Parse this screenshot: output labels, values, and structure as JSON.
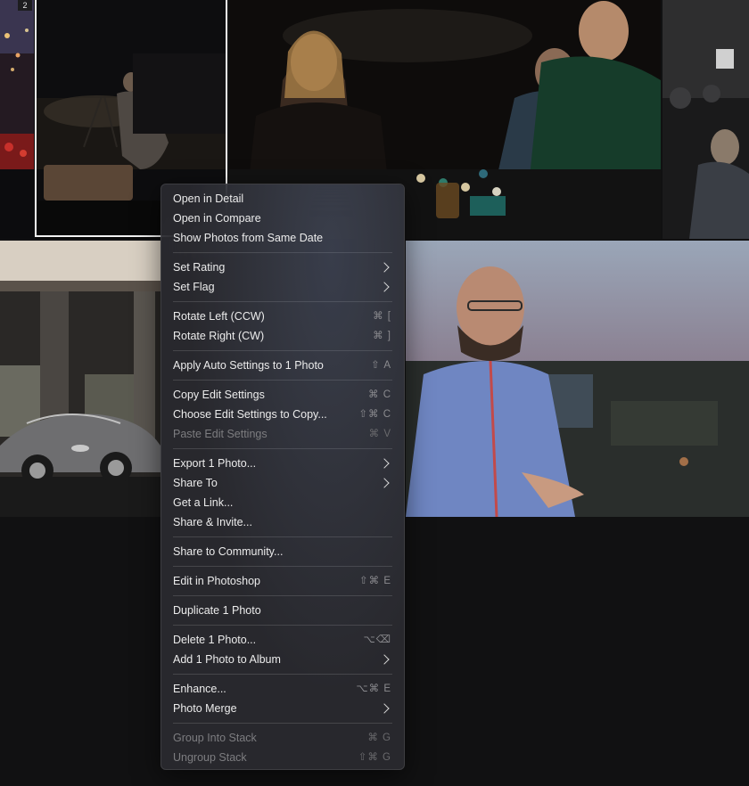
{
  "thumbnail_badge": "2",
  "menu": {
    "groups": [
      [
        {
          "label": "Open in Detail",
          "shortcut": "",
          "submenu": false,
          "disabled": false
        },
        {
          "label": "Open in Compare",
          "shortcut": "",
          "submenu": false,
          "disabled": false
        },
        {
          "label": "Show Photos from Same Date",
          "shortcut": "",
          "submenu": false,
          "disabled": false
        }
      ],
      [
        {
          "label": "Set Rating",
          "shortcut": "",
          "submenu": true,
          "disabled": false
        },
        {
          "label": "Set Flag",
          "shortcut": "",
          "submenu": true,
          "disabled": false
        }
      ],
      [
        {
          "label": "Rotate Left (CCW)",
          "shortcut": "⌘ [",
          "submenu": false,
          "disabled": false
        },
        {
          "label": "Rotate Right (CW)",
          "shortcut": "⌘ ]",
          "submenu": false,
          "disabled": false
        }
      ],
      [
        {
          "label": "Apply Auto Settings to 1 Photo",
          "shortcut": "⇧ A",
          "submenu": false,
          "disabled": false
        }
      ],
      [
        {
          "label": "Copy Edit Settings",
          "shortcut": "⌘ C",
          "submenu": false,
          "disabled": false
        },
        {
          "label": "Choose Edit Settings to Copy...",
          "shortcut": "⇧⌘ C",
          "submenu": false,
          "disabled": false
        },
        {
          "label": "Paste Edit Settings",
          "shortcut": "⌘ V",
          "submenu": false,
          "disabled": true
        }
      ],
      [
        {
          "label": "Export 1 Photo...",
          "shortcut": "",
          "submenu": true,
          "disabled": false
        },
        {
          "label": "Share To",
          "shortcut": "",
          "submenu": true,
          "disabled": false
        },
        {
          "label": "Get a Link...",
          "shortcut": "",
          "submenu": false,
          "disabled": false
        },
        {
          "label": "Share & Invite...",
          "shortcut": "",
          "submenu": false,
          "disabled": false
        }
      ],
      [
        {
          "label": "Share to Community...",
          "shortcut": "",
          "submenu": false,
          "disabled": false
        }
      ],
      [
        {
          "label": "Edit in Photoshop",
          "shortcut": "⇧⌘ E",
          "submenu": false,
          "disabled": false
        }
      ],
      [
        {
          "label": "Duplicate 1 Photo",
          "shortcut": "",
          "submenu": false,
          "disabled": false
        }
      ],
      [
        {
          "label": "Delete 1 Photo...",
          "shortcut": "⌥⌫",
          "submenu": false,
          "disabled": false
        },
        {
          "label": "Add 1 Photo to Album",
          "shortcut": "",
          "submenu": true,
          "disabled": false
        }
      ],
      [
        {
          "label": "Enhance...",
          "shortcut": "⌥⌘ E",
          "submenu": false,
          "disabled": false
        },
        {
          "label": "Photo Merge",
          "shortcut": "",
          "submenu": true,
          "disabled": false
        }
      ],
      [
        {
          "label": "Group Into Stack",
          "shortcut": "⌘ G",
          "submenu": false,
          "disabled": true
        },
        {
          "label": "Ungroup Stack",
          "shortcut": "⇧⌘ G",
          "submenu": false,
          "disabled": true
        }
      ]
    ]
  }
}
